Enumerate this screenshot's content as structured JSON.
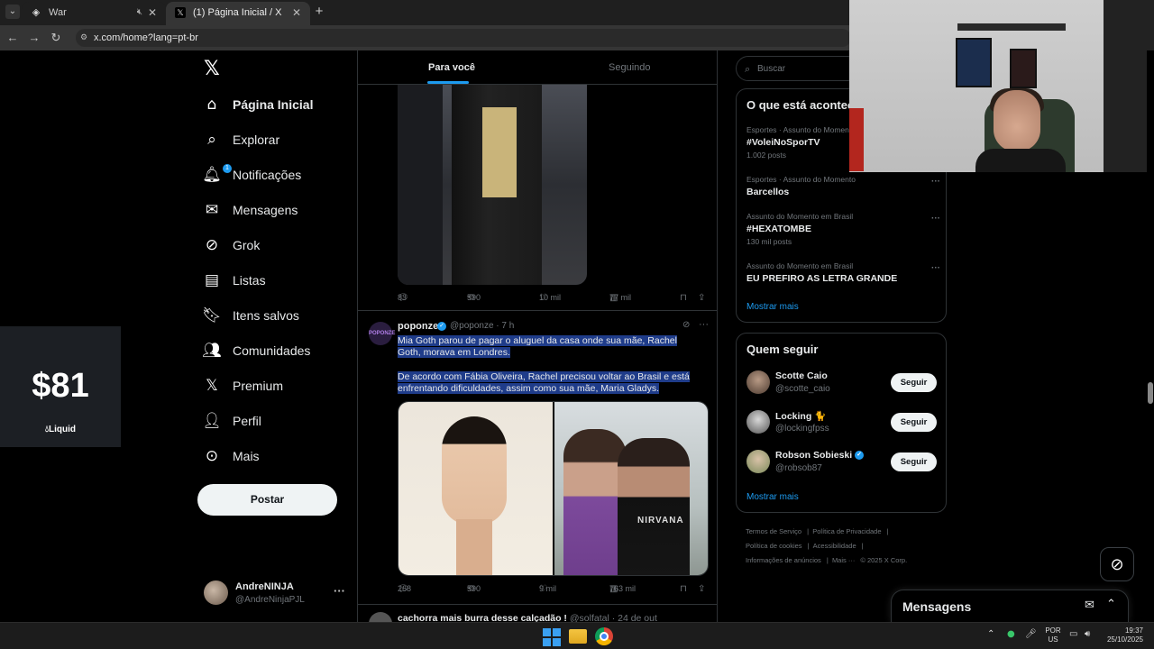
{
  "browser": {
    "tabs": [
      {
        "title": "War",
        "active": false
      },
      {
        "title": "(1) Página Inicial / X",
        "active": true
      }
    ],
    "url": "x.com/home?lang=pt-br"
  },
  "nav": {
    "items": [
      {
        "label": "Página Inicial",
        "icon": "home-icon",
        "active": true
      },
      {
        "label": "Explorar",
        "icon": "search-icon"
      },
      {
        "label": "Notificações",
        "icon": "bell-icon",
        "badge": "1"
      },
      {
        "label": "Mensagens",
        "icon": "envelope-icon"
      },
      {
        "label": "Grok",
        "icon": "grok-icon"
      },
      {
        "label": "Listas",
        "icon": "list-icon"
      },
      {
        "label": "Itens salvos",
        "icon": "bookmark-icon"
      },
      {
        "label": "Comunidades",
        "icon": "people-icon"
      },
      {
        "label": "Premium",
        "icon": "x-icon"
      },
      {
        "label": "Perfil",
        "icon": "person-icon"
      },
      {
        "label": "Mais",
        "icon": "more-circle-icon"
      }
    ],
    "post_label": "Postar",
    "account": {
      "name": "AndreNINJA",
      "handle": "@AndreNinjaPJL"
    }
  },
  "liquid_widget": {
    "price": "$81",
    "label": "Liquid"
  },
  "feed": {
    "tabs": [
      "Para você",
      "Seguindo"
    ],
    "tweet1_actions": {
      "replies": "83",
      "retweets": "590",
      "likes": "10 mil",
      "views": "77 mil"
    },
    "tweet2": {
      "author": "poponze",
      "handle": "@poponze · 7 h",
      "avatar_text": "POPONZE",
      "text_line1": "Mia Goth parou de pagar o aluguel da casa onde sua mãe, Rachel Goth, morava em Londres.",
      "text_line2": "De acordo com Fábia Oliveira, Rachel precisou voltar ao Brasil e está enfrentando dificuldades, assim como sua mãe, Maria Gladys.",
      "image_text": "NIRVANA",
      "actions": {
        "replies": "268",
        "retweets": "590",
        "likes": "9 mil",
        "views": "763 mil"
      }
    },
    "tweet3": {
      "text": "cachorra mais burra desse calçadão !",
      "handle": "@solfatal · 24 de out"
    }
  },
  "sidebar": {
    "search_placeholder": "Buscar",
    "trends_title": "O que está acontecendo",
    "trends": [
      {
        "meta": "Esportes · Assunto do Momento",
        "name": "#VoleiNoSporTV",
        "posts": "1.002 posts"
      },
      {
        "meta": "Esportes · Assunto do Momento",
        "name": "Barcellos",
        "posts": ""
      },
      {
        "meta": "Assunto do Momento em Brasil",
        "name": "#HEXATOMBE",
        "posts": "130 mil posts"
      },
      {
        "meta": "Assunto do Momento em Brasil",
        "name": "EU PREFIRO AS LETRA GRANDE",
        "posts": ""
      }
    ],
    "show_more": "Mostrar mais",
    "follow_title": "Quem seguir",
    "follow": [
      {
        "name": "Scotte Caio",
        "handle": "@scotte_caio",
        "button": "Seguir"
      },
      {
        "name": "Locking 🐈",
        "handle": "@lockingfpss",
        "button": "Seguir"
      },
      {
        "name": "Robson Sobieski",
        "handle": "@robsob87",
        "button": "Seguir",
        "verified": true
      }
    ],
    "footer": {
      "terms": "Termos de Serviço",
      "privacy": "Política de Privacidade",
      "cookies": "Política de cookies",
      "access": "Acessibilidade",
      "ads": "Informações de anúncios",
      "more": "Mais ···",
      "copyright": "© 2025 X Corp."
    }
  },
  "messages_drawer": {
    "title": "Mensagens"
  },
  "taskbar": {
    "lang_top": "POR",
    "lang_bottom": "US",
    "time": "19:37",
    "date": "25/10/2025"
  },
  "colors": {
    "accent": "#1d9bf0",
    "background": "#000000",
    "highlight": "#1f3c8a"
  }
}
